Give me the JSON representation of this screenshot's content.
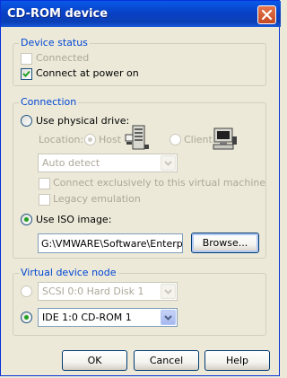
{
  "window": {
    "title": "CD-ROM device"
  },
  "device_status": {
    "label": "Device status",
    "connected_label": "Connected",
    "connected_checked": false,
    "connect_power_label": "Connect at power on",
    "connect_power_checked": true
  },
  "connection": {
    "label": "Connection",
    "physical_label": "Use physical drive:",
    "location_label": "Location:",
    "host_label": "Host",
    "client_label": "Client",
    "drive_select_value": "Auto detect",
    "exclusive_label": "Connect exclusively to this virtual machine",
    "legacy_label": "Legacy emulation",
    "iso_label": "Use ISO image:",
    "iso_path": "G:\\VMWARE\\Software\\Enterpri",
    "browse_label": "Browse..."
  },
  "virtual_device_node": {
    "label": "Virtual device node",
    "scsi_value": "SCSI 0:0   Hard Disk 1",
    "ide_value": "IDE 1:0   CD-ROM 1"
  },
  "footer": {
    "ok_label": "OK",
    "cancel_label": "Cancel",
    "help_label": "Help"
  },
  "icons": {
    "close": "close-icon",
    "host": "host-computer-icon",
    "client": "client-computer-icon",
    "check": "checkmark-icon",
    "dropdown": "chevron-down-icon"
  },
  "colors": {
    "title_bar": "#0841c6",
    "group_label": "#0046d5",
    "close_button": "#c44a25",
    "radio_selected": "#21a121",
    "disabled_text": "#aca899"
  }
}
